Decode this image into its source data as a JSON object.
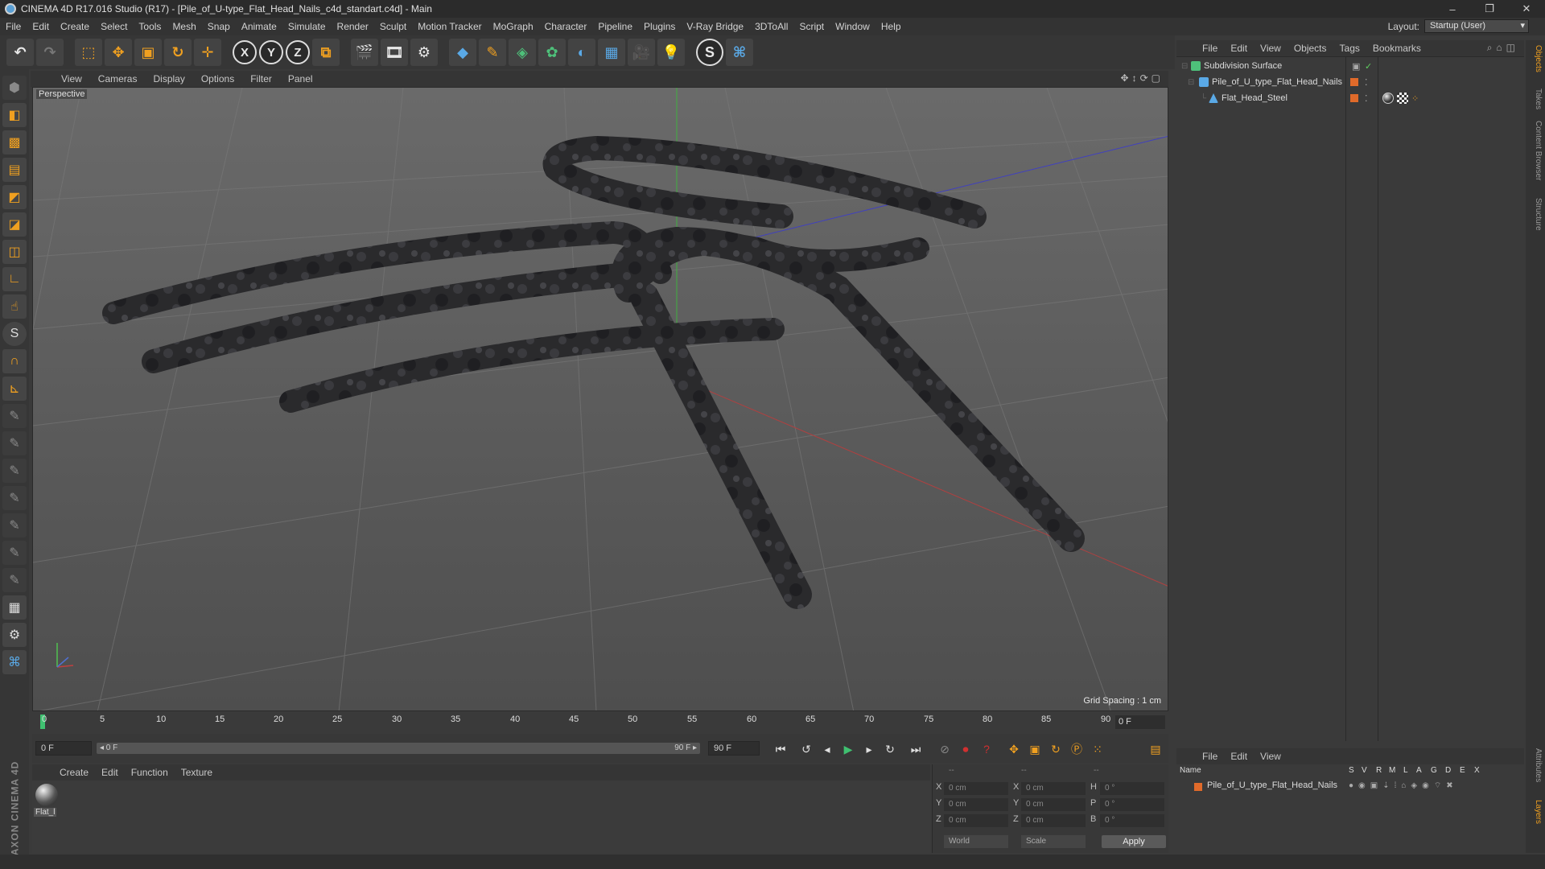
{
  "window": {
    "title": "CINEMA 4D R17.016 Studio (R17) - [Pile_of_U-type_Flat_Head_Nails_c4d_standart.c4d] - Main",
    "minimize": "–",
    "maximize": "❐",
    "close": "✕"
  },
  "menu": [
    "File",
    "Edit",
    "Create",
    "Select",
    "Tools",
    "Mesh",
    "Snap",
    "Animate",
    "Simulate",
    "Render",
    "Sculpt",
    "Motion Tracker",
    "MoGraph",
    "Character",
    "Pipeline",
    "Plugins",
    "V-Ray Bridge",
    "3DToAll",
    "Script",
    "Window",
    "Help"
  ],
  "layout": {
    "label": "Layout:",
    "value": "Startup (User)"
  },
  "toolbar": {
    "axis_x": "X",
    "axis_y": "Y",
    "axis_z": "Z"
  },
  "viewport": {
    "menu": [
      "View",
      "Cameras",
      "Display",
      "Options",
      "Filter",
      "Panel"
    ],
    "label": "Perspective",
    "grid_spacing": "Grid Spacing : 1 cm"
  },
  "timeline": {
    "ticks": [
      "0",
      "5",
      "10",
      "15",
      "20",
      "25",
      "30",
      "35",
      "40",
      "45",
      "50",
      "55",
      "60",
      "65",
      "70",
      "75",
      "80",
      "85",
      "90"
    ],
    "current_frame": "0 F"
  },
  "transport": {
    "start_field": "0 F",
    "range_start": "◂ 0 F",
    "range_end": "90 F ▸",
    "end_field": "90 F"
  },
  "material_manager": {
    "menu": [
      "Create",
      "Edit",
      "Function",
      "Texture"
    ],
    "material_name": "Flat_l"
  },
  "coordinates": {
    "header_pos": "--",
    "header_size": "--",
    "header_rot": "--",
    "rows": [
      {
        "axis": "X",
        "pos": "0 cm",
        "size_axis": "X",
        "size": "0 cm",
        "rot_axis": "H",
        "rot": "0 °"
      },
      {
        "axis": "Y",
        "pos": "0 cm",
        "size_axis": "Y",
        "size": "0 cm",
        "rot_axis": "P",
        "rot": "0 °"
      },
      {
        "axis": "Z",
        "pos": "0 cm",
        "size_axis": "Z",
        "size": "0 cm",
        "rot_axis": "B",
        "rot": "0 °"
      }
    ],
    "mode_world": "World",
    "mode_scale": "Scale",
    "apply": "Apply"
  },
  "object_manager": {
    "menu": [
      "File",
      "Edit",
      "View",
      "Objects",
      "Tags",
      "Bookmarks"
    ],
    "objects": [
      {
        "name": "Subdivision Surface",
        "depth": 0
      },
      {
        "name": "Pile_of_U_type_Flat_Head_Nails",
        "depth": 1
      },
      {
        "name": "Flat_Head_Steel",
        "depth": 2
      }
    ]
  },
  "layer_manager": {
    "menu": [
      "File",
      "Edit",
      "View"
    ],
    "columns": [
      "Name",
      "S",
      "V",
      "R",
      "M",
      "L",
      "A",
      "G",
      "D",
      "E",
      "X"
    ],
    "layer_name": "Pile_of_U_type_Flat_Head_Nails"
  },
  "side_tabs": [
    "Objects",
    "Takes",
    "Content Browser",
    "Structure",
    "Attributes",
    "Layers"
  ],
  "maxon_logo": "MAXON CINEMA 4D",
  "colors": {
    "accent": "#f0a020",
    "layer_color": "#e06a2a",
    "playhead": "#3fc070"
  }
}
